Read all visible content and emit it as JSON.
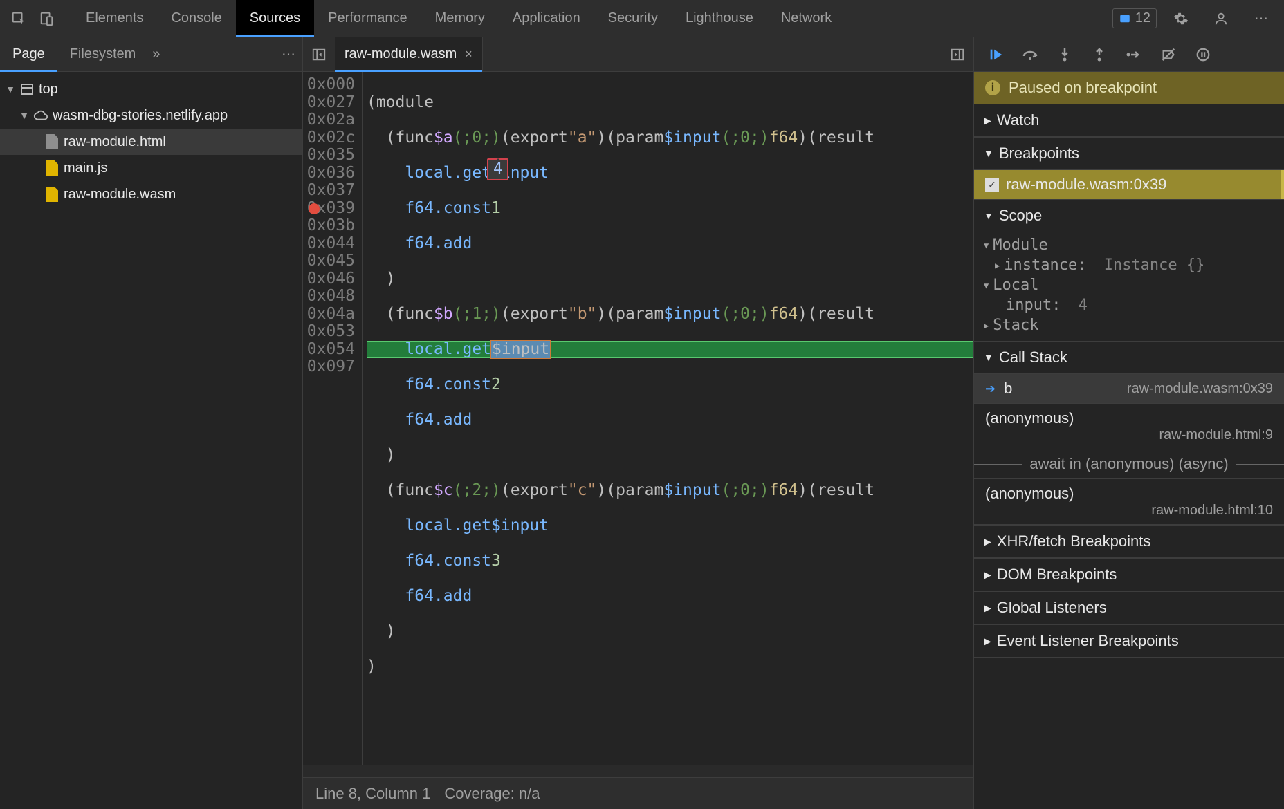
{
  "topbar": {
    "tabs": [
      "Elements",
      "Console",
      "Sources",
      "Performance",
      "Memory",
      "Application",
      "Security",
      "Lighthouse",
      "Network"
    ],
    "active": "Sources",
    "issuesCount": "12"
  },
  "sidebar": {
    "tabs": [
      "Page",
      "Filesystem"
    ],
    "active": "Page",
    "tree": {
      "root": "top",
      "domain": "wasm-dbg-stories.netlify.app",
      "files": [
        "raw-module.html",
        "main.js",
        "raw-module.wasm"
      ],
      "selected": "raw-module.html"
    }
  },
  "editor": {
    "openFile": "raw-module.wasm",
    "tooltipValue": "4",
    "gutter": [
      "0x000",
      "0x027",
      "0x02a",
      "0x02c",
      "0x035",
      "0x036",
      "0x037",
      "0x039",
      "0x03b",
      "0x044",
      "0x045",
      "0x046",
      "0x048",
      "0x04a",
      "0x053",
      "0x054",
      "0x097"
    ],
    "breakpointGutterIndex": 7,
    "execLineIndex": 7,
    "statusbar": {
      "pos": "Line 8, Column 1",
      "coverage": "Coverage: n/a"
    }
  },
  "code": {
    "funcA": {
      "name": "$a",
      "slot": "(;0;)",
      "export": "\"a\"",
      "param": "$input",
      "pslot": "(;0;)",
      "type": "f64",
      "const": "1"
    },
    "funcB": {
      "name": "$b",
      "slot": "(;1;)",
      "export": "\"b\"",
      "param": "$input",
      "pslot": "(;0;)",
      "type": "f64",
      "const": "2"
    },
    "funcC": {
      "name": "$c",
      "slot": "(;2;)",
      "export": "\"c\"",
      "param": "$input",
      "pslot": "(;0;)",
      "type": "f64",
      "const": "3"
    },
    "localget": "local.get",
    "f64const": "f64.const",
    "f64add": "f64.add",
    "module": "module",
    "func": "func",
    "export": "export",
    "param": "param",
    "result": "result"
  },
  "debugger": {
    "pauseBanner": "Paused on breakpoint",
    "sections": {
      "watch": "Watch",
      "breakpoints": "Breakpoints",
      "scope": "Scope",
      "callstack": "Call Stack",
      "xhr": "XHR/fetch Breakpoints",
      "dom": "DOM Breakpoints",
      "global": "Global Listeners",
      "event": "Event Listener Breakpoints"
    },
    "breakpointItem": "raw-module.wasm:0x39",
    "scope": {
      "module": "Module",
      "instanceKey": "instance:",
      "instanceVal": "Instance {}",
      "local": "Local",
      "inputKey": "input:",
      "inputVal": "4",
      "stack": "Stack"
    },
    "callstack": [
      {
        "fn": "b",
        "loc": "raw-module.wasm:0x39",
        "current": true
      },
      {
        "fn": "(anonymous)",
        "loc": "raw-module.html:9"
      }
    ],
    "asyncLabel": "await in (anonymous) (async)",
    "callstack2": [
      {
        "fn": "(anonymous)",
        "loc": "raw-module.html:10"
      }
    ]
  }
}
